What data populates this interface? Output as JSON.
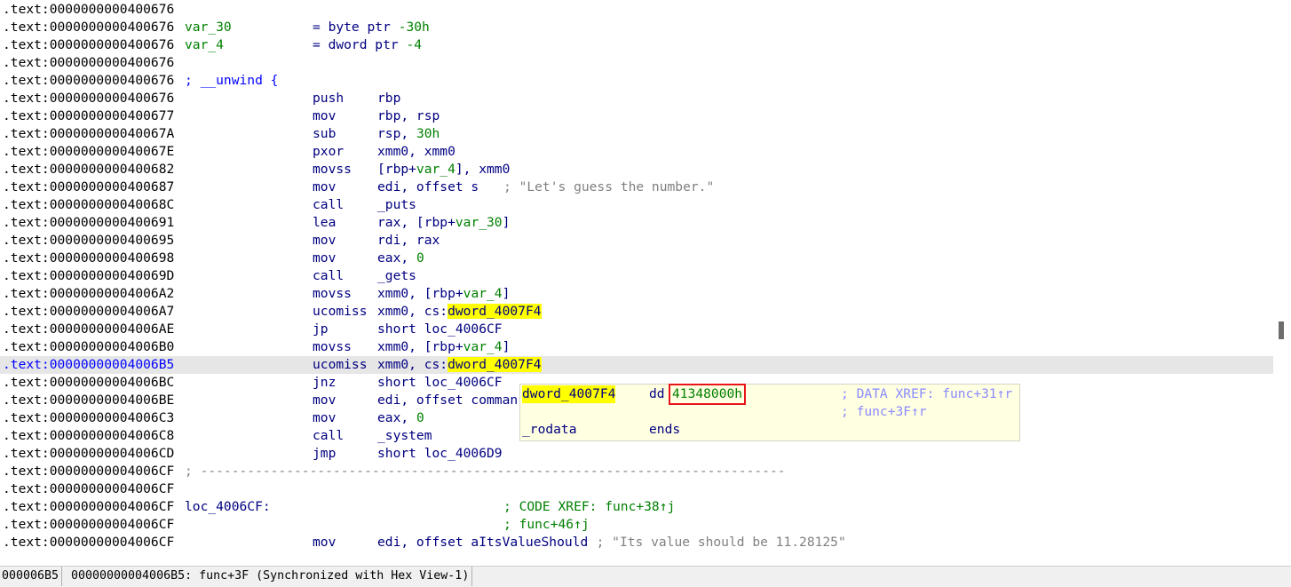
{
  "listing": {
    "lines": [
      {
        "addr": ".text:0000000000400676"
      },
      {
        "addr": ".text:0000000000400676",
        "label": "var_30",
        "mnem": "= byte ptr -30h"
      },
      {
        "addr": ".text:0000000000400676",
        "label": "var_4",
        "mnem": "= dword ptr -4"
      },
      {
        "addr": ".text:0000000000400676"
      },
      {
        "addr": ".text:0000000000400676",
        "label": "; __unwind {"
      },
      {
        "addr": ".text:0000000000400676",
        "mnem": "push",
        "ops": "rbp"
      },
      {
        "addr": ".text:0000000000400677",
        "mnem": "mov",
        "ops": "rbp, rsp"
      },
      {
        "addr": ".text:000000000040067A",
        "mnem": "sub",
        "ops": "rsp, 30h"
      },
      {
        "addr": ".text:000000000040067E",
        "mnem": "pxor",
        "ops": "xmm0, xmm0"
      },
      {
        "addr": ".text:0000000000400682",
        "mnem": "movss",
        "ops": "[rbp+var_4], xmm0"
      },
      {
        "addr": ".text:0000000000400687",
        "mnem": "mov",
        "ops": "edi, offset s",
        "comment": "; \"Let's guess the number.\""
      },
      {
        "addr": ".text:000000000040068C",
        "mnem": "call",
        "ops": "_puts"
      },
      {
        "addr": ".text:0000000000400691",
        "mnem": "lea",
        "ops": "rax, [rbp+var_30]"
      },
      {
        "addr": ".text:0000000000400695",
        "mnem": "mov",
        "ops": "rdi, rax"
      },
      {
        "addr": ".text:0000000000400698",
        "mnem": "mov",
        "ops": "eax, 0"
      },
      {
        "addr": ".text:000000000040069D",
        "mnem": "call",
        "ops": "_gets"
      },
      {
        "addr": ".text:00000000004006A2",
        "mnem": "movss",
        "ops": "xmm0, [rbp+var_4]"
      },
      {
        "addr": ".text:00000000004006A7",
        "mnem": "ucomiss",
        "ops": "xmm0, cs:dword_4007F4"
      },
      {
        "addr": ".text:00000000004006AE",
        "mnem": "jp",
        "ops": "short loc_4006CF"
      },
      {
        "addr": ".text:00000000004006B0",
        "mnem": "movss",
        "ops": "xmm0, [rbp+var_4]"
      },
      {
        "addr": ".text:00000000004006B5",
        "mnem": "ucomiss",
        "ops": "xmm0, cs:dword_4007F4"
      },
      {
        "addr": ".text:00000000004006BC",
        "mnem": "jnz",
        "ops": "short loc_4006CF"
      },
      {
        "addr": ".text:00000000004006BE",
        "mnem": "mov",
        "ops": "edi, offset comman"
      },
      {
        "addr": ".text:00000000004006C3",
        "mnem": "mov",
        "ops": "eax, 0"
      },
      {
        "addr": ".text:00000000004006C8",
        "mnem": "call",
        "ops": "_system"
      },
      {
        "addr": ".text:00000000004006CD",
        "mnem": "jmp",
        "ops": "short loc_4006D9"
      },
      {
        "addr": ".text:00000000004006CF",
        "separator": "; ---------------------------------------------------------------------------"
      },
      {
        "addr": ".text:00000000004006CF"
      },
      {
        "addr": ".text:00000000004006CF",
        "label": "loc_4006CF:",
        "xref": "; CODE XREF: func+38↑j"
      },
      {
        "addr": ".text:00000000004006CF",
        "xref": "; func+46↑j"
      },
      {
        "addr": ".text:00000000004006CF",
        "mnem": "mov",
        "ops": "edi, offset aItsValueShould",
        "comment": "; \"Its value should be 11.28125\""
      }
    ]
  },
  "hint": {
    "name": "dword_4007F4",
    "directive": "dd",
    "value": "41348000h",
    "xref1": "; DATA XREF: func+31↑r",
    "xref2": "; func+3F↑r",
    "segment": "_rodata",
    "ends": "ends"
  },
  "status": {
    "offset": "000006B5",
    "location": "00000000004006B5: func+3F",
    "sync": "(Synchronized with Hex View-1)"
  },
  "colors": {
    "highlight": "#ffff00",
    "current_line": "#e6e6e6",
    "value_box": "#e8141c",
    "address": "#000000",
    "current_address": "#0000ff"
  }
}
